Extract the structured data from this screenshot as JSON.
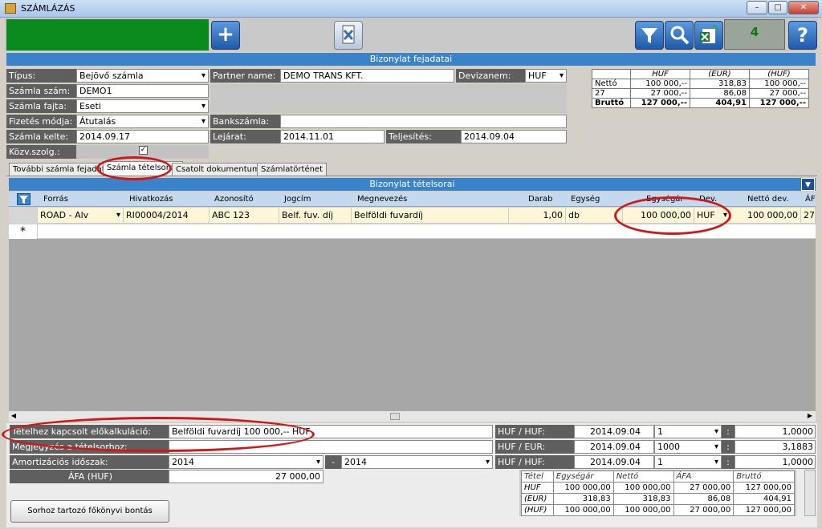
{
  "window": {
    "title": "SZÁMLÁZÁS"
  },
  "toolbar": {
    "counter": "4"
  },
  "header": {
    "title": "Bizonylat fejadatai"
  },
  "form": {
    "tipus_label": "Típus:",
    "tipus_value": "Bejövő számla",
    "szamlaszam_label": "Számla szám:",
    "szamlaszam_value": "DEMO1",
    "fajta_label": "Számla fajta:",
    "fajta_value": "Eseti",
    "fizetes_label": "Fizetés módja:",
    "fizetes_value": "Átutalás",
    "kelte_label": "Számla kelte:",
    "kelte_value": "2014.09.17",
    "kozv_label": "Közv.szolg.:",
    "partner_label": "Partner name:",
    "partner_value": "DEMO TRANS KFT.",
    "deviza_label": "Devizanem:",
    "deviza_value": "HUF",
    "bank_label": "Bankszámla:",
    "bank_value": "",
    "lejarat_label": "Lejárat:",
    "lejarat_value": "2014.11.01",
    "teljesites_label": "Teljesítés:",
    "teljesites_value": "2014.09.04"
  },
  "summary": {
    "headers": [
      "",
      "HUF",
      "(EUR)",
      "(HUF)"
    ],
    "rows": [
      [
        "Nettó",
        "100 000,--",
        "318,83",
        "100 000,--"
      ],
      [
        "27",
        "27 000,--",
        "86,08",
        "27 000,--"
      ],
      [
        "Bruttó",
        "127 000,--",
        "404,91",
        "127 000,--"
      ]
    ]
  },
  "tabs": [
    "További számla fejadatok",
    "Számla tételsorok",
    "Csatolt dokumentumok",
    "Számlatörténet"
  ],
  "items": {
    "title": "Bizonylat tételsorai",
    "columns": [
      "Forrás",
      "Hivatkozás",
      "Azonosító",
      "Jogcím",
      "Megnevezés",
      "Darab",
      "Egység",
      "Egységár",
      "Dev.",
      "Nettó dev.",
      "ÁF"
    ],
    "row": {
      "forras": "ROAD - Alv",
      "hivatkozas": "RI00004/2014",
      "azonosito": "ABC 123",
      "jogcim": "Belf. fuv. díj",
      "megnevezes": "Belföldi fuvardíj",
      "darab": "1,00",
      "egyseg": "db",
      "egysegar": "100 000,00",
      "dev": "HUF",
      "netto_dev": "100 000,00",
      "af": "27"
    },
    "new_row_marker": "*"
  },
  "bottom": {
    "elokalk_label": "Tételhez kapcsolt előkalkuláció:",
    "elokalk_value": "Belföldi fuvardíj 100 000,-- HUF",
    "megjegyzes_label": "Megjegyzés a tételsorhoz:",
    "megjegyzes_value": "",
    "amort_label": "Amortizációs időszak:",
    "amort_from": "2014",
    "amort_sep": "-",
    "amort_to": "2014",
    "afa_label": "ÁFA (HUF)",
    "afa_value": "27 000,00",
    "bontas_button": "Sorhoz tartozó főkönyvi bontás"
  },
  "rates": [
    {
      "pair": "HUF / HUF:",
      "date": "2014.09.04",
      "unit": "1",
      "sep": ":",
      "rate": "1,0000"
    },
    {
      "pair": "HUF / EUR:",
      "date": "2014.09.04",
      "unit": "1000",
      "sep": ":",
      "rate": "3,1883"
    },
    {
      "pair": "HUF / HUF:",
      "date": "2014.09.04",
      "unit": "1",
      "sep": ":",
      "rate": "1,0000"
    }
  ],
  "line_summary": {
    "headers": [
      "Tétel",
      "Egységár",
      "Nettó",
      "ÁFA",
      "Bruttó"
    ],
    "rows": [
      [
        "HUF",
        "100 000,00",
        "100 000,00",
        "27 000,00",
        "127 000,00"
      ],
      [
        "(EUR)",
        "318,83",
        "318,83",
        "86,08",
        "404,91"
      ],
      [
        "(HUF)",
        "100 000,00",
        "100 000,00",
        "27 000,00",
        "127 000,00"
      ]
    ]
  }
}
